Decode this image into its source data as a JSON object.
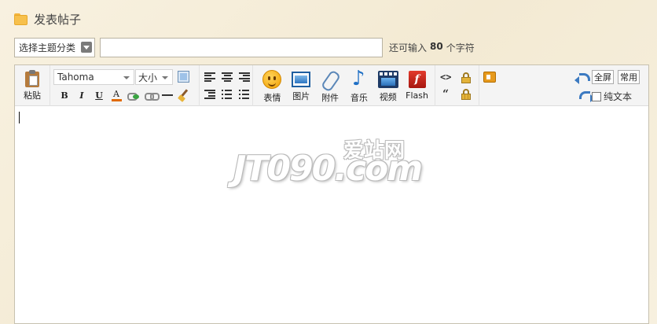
{
  "header": {
    "title": "发表帖子",
    "icon": "folder-icon"
  },
  "topic": {
    "category_select": "选择主题分类",
    "title_value": "",
    "char_hint_prefix": "还可输入",
    "char_count": "80",
    "char_hint_suffix": "个字符"
  },
  "toolbar": {
    "paste_label": "粘贴",
    "font_family": "Tahoma",
    "font_size": "大小",
    "format": {
      "bold": "B",
      "italic": "I",
      "underline": "U",
      "color": "A"
    },
    "media": [
      {
        "label": "表情",
        "icon": "smiley-icon"
      },
      {
        "label": "图片",
        "icon": "image-icon"
      },
      {
        "label": "附件",
        "icon": "attachment-icon"
      },
      {
        "label": "音乐",
        "icon": "music-icon"
      },
      {
        "label": "视频",
        "icon": "video-icon"
      },
      {
        "label": "Flash",
        "icon": "flash-icon"
      }
    ],
    "code_symbol": "<>",
    "quote_symbol": "“",
    "fullscreen_label": "全屏",
    "common_label": "常用",
    "plain_text_label": "纯文本"
  },
  "watermark": {
    "main": "JT090.com",
    "sub": "爱站网"
  },
  "colors": {
    "accent_orange": "#f7c04c",
    "link_blue": "#3c7ac1",
    "page_bg": "#f6efdc"
  }
}
